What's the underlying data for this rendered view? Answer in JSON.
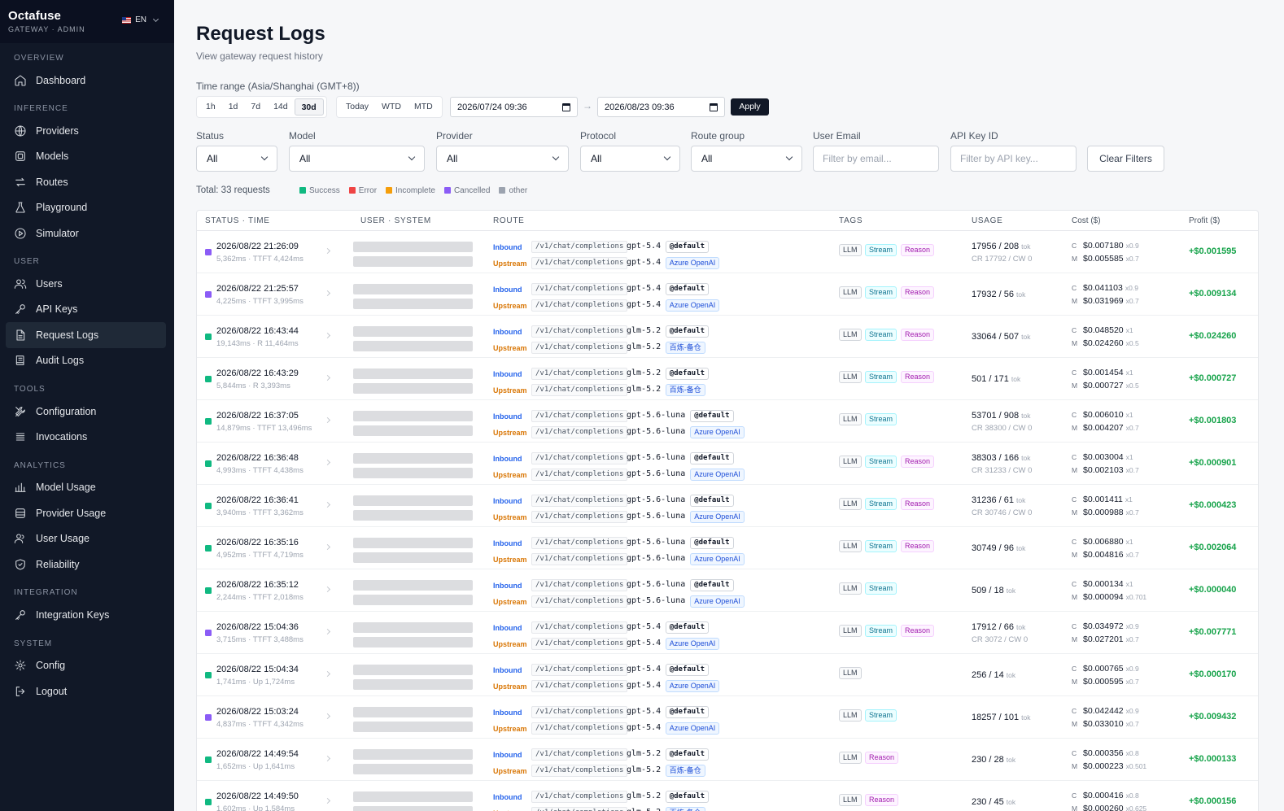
{
  "brand": {
    "name": "Octafuse",
    "sub": "GATEWAY · ADMIN",
    "lang": "EN"
  },
  "nav": [
    {
      "section": "OVERVIEW",
      "items": [
        {
          "label": "Dashboard",
          "icon": "home-icon"
        }
      ]
    },
    {
      "section": "INFERENCE",
      "items": [
        {
          "label": "Providers",
          "icon": "globe-icon"
        },
        {
          "label": "Models",
          "icon": "cube-icon"
        },
        {
          "label": "Routes",
          "icon": "arrows-icon"
        },
        {
          "label": "Playground",
          "icon": "flask-icon"
        },
        {
          "label": "Simulator",
          "icon": "play-circle-icon"
        }
      ]
    },
    {
      "section": "USER",
      "items": [
        {
          "label": "Users",
          "icon": "users-icon"
        },
        {
          "label": "API Keys",
          "icon": "key-icon"
        },
        {
          "label": "Request Logs",
          "icon": "file-icon",
          "active": true
        },
        {
          "label": "Audit Logs",
          "icon": "book-icon"
        }
      ]
    },
    {
      "section": "TOOLS",
      "items": [
        {
          "label": "Configuration",
          "icon": "tools-icon"
        },
        {
          "label": "Invocations",
          "icon": "list-icon"
        }
      ]
    },
    {
      "section": "ANALYTICS",
      "items": [
        {
          "label": "Model Usage",
          "icon": "bar-chart-icon"
        },
        {
          "label": "Provider Usage",
          "icon": "database-icon"
        },
        {
          "label": "User Usage",
          "icon": "user-group-icon"
        },
        {
          "label": "Reliability",
          "icon": "shield-icon"
        }
      ]
    },
    {
      "section": "INTEGRATION",
      "items": [
        {
          "label": "Integration Keys",
          "icon": "key-icon"
        }
      ]
    },
    {
      "section": "SYSTEM",
      "items": [
        {
          "label": "Config",
          "icon": "gear-icon"
        },
        {
          "label": "Logout",
          "icon": "logout-icon"
        }
      ]
    }
  ],
  "page": {
    "title": "Request Logs",
    "subtitle": "View gateway request history"
  },
  "time": {
    "label": "Time range (Asia/Shanghai (GMT+8))",
    "quick": [
      "1h",
      "1d",
      "7d",
      "14d",
      "30d"
    ],
    "quick_active": "30d",
    "periods": [
      "Today",
      "WTD",
      "MTD"
    ],
    "from": "2026/07/24 09:36",
    "to": "2026/08/23 09:36",
    "arrow": "→",
    "apply": "Apply"
  },
  "filters": {
    "status": {
      "label": "Status",
      "value": "All"
    },
    "model": {
      "label": "Model",
      "value": "All"
    },
    "provider": {
      "label": "Provider",
      "value": "All"
    },
    "protocol": {
      "label": "Protocol",
      "value": "All"
    },
    "route_group": {
      "label": "Route group",
      "value": "All"
    },
    "user_email": {
      "label": "User Email",
      "placeholder": "Filter by email..."
    },
    "api_key": {
      "label": "API Key ID",
      "placeholder": "Filter by API key..."
    },
    "clear": "Clear Filters"
  },
  "summary": {
    "total": "Total: 33 requests",
    "legend": [
      {
        "label": "Success",
        "color": "#10b981"
      },
      {
        "label": "Error",
        "color": "#ef4444"
      },
      {
        "label": "Incomplete",
        "color": "#f59e0b"
      },
      {
        "label": "Cancelled",
        "color": "#8b5cf6"
      },
      {
        "label": "other",
        "color": "#9ca3af"
      }
    ]
  },
  "columns": {
    "status_time": "STATUS · TIME",
    "user_system": "USER · SYSTEM",
    "route": "ROUTE",
    "tags": "TAGS",
    "usage": "USAGE",
    "cost": "Cost ($)",
    "profit": "Profit ($)"
  },
  "route_labels": {
    "inbound": "Inbound",
    "upstream": "Upstream",
    "default_badge": "@default",
    "tok": "tok",
    "c": "C",
    "m": "M"
  },
  "rows": [
    {
      "status": "cancelled",
      "time": "2026/08/22 21:26:09",
      "sub": "5,362ms · TTFT 4,424ms",
      "path": "/v1/chat/completions",
      "model": "gpt-5.4",
      "provider": "Azure OpenAI",
      "tags": [
        "LLM",
        "Stream",
        "Reason"
      ],
      "usage": "17956 / 208",
      "cache": "CR 17792 / CW 0",
      "cost_c": "$0.007180",
      "mult_c": "x0.9",
      "cost_m": "$0.005585",
      "mult_m": "x0.7",
      "profit": "+$0.001595"
    },
    {
      "status": "cancelled",
      "time": "2026/08/22 21:25:57",
      "sub": "4,225ms · TTFT 3,995ms",
      "path": "/v1/chat/completions",
      "model": "gpt-5.4",
      "provider": "Azure OpenAI",
      "tags": [
        "LLM",
        "Stream",
        "Reason"
      ],
      "usage": "17932 / 56",
      "cache": "",
      "cost_c": "$0.041103",
      "mult_c": "x0.9",
      "cost_m": "$0.031969",
      "mult_m": "x0.7",
      "profit": "+$0.009134"
    },
    {
      "status": "success",
      "time": "2026/08/22 16:43:44",
      "sub": "19,143ms · R 11,464ms",
      "path": "/v1/chat/completions",
      "model": "glm-5.2",
      "provider": "百炼-备仓",
      "tags": [
        "LLM",
        "Stream",
        "Reason"
      ],
      "usage": "33064 / 507",
      "cache": "",
      "cost_c": "$0.048520",
      "mult_c": "x1",
      "cost_m": "$0.024260",
      "mult_m": "x0.5",
      "profit": "+$0.024260"
    },
    {
      "status": "success",
      "time": "2026/08/22 16:43:29",
      "sub": "5,844ms · R 3,393ms",
      "path": "/v1/chat/completions",
      "model": "glm-5.2",
      "provider": "百炼-备仓",
      "tags": [
        "LLM",
        "Stream",
        "Reason"
      ],
      "usage": "501 / 171",
      "cache": "",
      "cost_c": "$0.001454",
      "mult_c": "x1",
      "cost_m": "$0.000727",
      "mult_m": "x0.5",
      "profit": "+$0.000727"
    },
    {
      "status": "success",
      "time": "2026/08/22 16:37:05",
      "sub": "14,879ms · TTFT 13,496ms",
      "path": "/v1/chat/completions",
      "model": "gpt-5.6-luna",
      "provider": "Azure OpenAI",
      "tags": [
        "LLM",
        "Stream"
      ],
      "usage": "53701 / 908",
      "cache": "CR 38300 / CW 0",
      "cost_c": "$0.006010",
      "mult_c": "x1",
      "cost_m": "$0.004207",
      "mult_m": "x0.7",
      "profit": "+$0.001803"
    },
    {
      "status": "success",
      "time": "2026/08/22 16:36:48",
      "sub": "4,993ms · TTFT 4,438ms",
      "path": "/v1/chat/completions",
      "model": "gpt-5.6-luna",
      "provider": "Azure OpenAI",
      "tags": [
        "LLM",
        "Stream",
        "Reason"
      ],
      "usage": "38303 / 166",
      "cache": "CR 31233 / CW 0",
      "cost_c": "$0.003004",
      "mult_c": "x1",
      "cost_m": "$0.002103",
      "mult_m": "x0.7",
      "profit": "+$0.000901"
    },
    {
      "status": "success",
      "time": "2026/08/22 16:36:41",
      "sub": "3,940ms · TTFT 3,362ms",
      "path": "/v1/chat/completions",
      "model": "gpt-5.6-luna",
      "provider": "Azure OpenAI",
      "tags": [
        "LLM",
        "Stream",
        "Reason"
      ],
      "usage": "31236 / 61",
      "cache": "CR 30746 / CW 0",
      "cost_c": "$0.001411",
      "mult_c": "x1",
      "cost_m": "$0.000988",
      "mult_m": "x0.7",
      "profit": "+$0.000423"
    },
    {
      "status": "success",
      "time": "2026/08/22 16:35:16",
      "sub": "4,952ms · TTFT 4,719ms",
      "path": "/v1/chat/completions",
      "model": "gpt-5.6-luna",
      "provider": "Azure OpenAI",
      "tags": [
        "LLM",
        "Stream",
        "Reason"
      ],
      "usage": "30749 / 96",
      "cache": "",
      "cost_c": "$0.006880",
      "mult_c": "x1",
      "cost_m": "$0.004816",
      "mult_m": "x0.7",
      "profit": "+$0.002064"
    },
    {
      "status": "success",
      "time": "2026/08/22 16:35:12",
      "sub": "2,244ms · TTFT 2,018ms",
      "path": "/v1/chat/completions",
      "model": "gpt-5.6-luna",
      "provider": "Azure OpenAI",
      "tags": [
        "LLM",
        "Stream"
      ],
      "usage": "509 / 18",
      "cache": "",
      "cost_c": "$0.000134",
      "mult_c": "x1",
      "cost_m": "$0.000094",
      "mult_m": "x0.701",
      "profit": "+$0.000040"
    },
    {
      "status": "cancelled",
      "time": "2026/08/22 15:04:36",
      "sub": "3,715ms · TTFT 3,488ms",
      "path": "/v1/chat/completions",
      "model": "gpt-5.4",
      "provider": "Azure OpenAI",
      "tags": [
        "LLM",
        "Stream",
        "Reason"
      ],
      "usage": "17912 / 66",
      "cache": "CR 3072 / CW 0",
      "cost_c": "$0.034972",
      "mult_c": "x0.9",
      "cost_m": "$0.027201",
      "mult_m": "x0.7",
      "profit": "+$0.007771"
    },
    {
      "status": "success",
      "time": "2026/08/22 15:04:34",
      "sub": "1,741ms · Up 1,724ms",
      "path": "/v1/chat/completions",
      "model": "gpt-5.4",
      "provider": "Azure OpenAI",
      "tags": [
        "LLM"
      ],
      "usage": "256 / 14",
      "cache": "",
      "cost_c": "$0.000765",
      "mult_c": "x0.9",
      "cost_m": "$0.000595",
      "mult_m": "x0.7",
      "profit": "+$0.000170"
    },
    {
      "status": "cancelled",
      "time": "2026/08/22 15:03:24",
      "sub": "4,837ms · TTFT 4,342ms",
      "path": "/v1/chat/completions",
      "model": "gpt-5.4",
      "provider": "Azure OpenAI",
      "tags": [
        "LLM",
        "Stream"
      ],
      "usage": "18257 / 101",
      "cache": "",
      "cost_c": "$0.042442",
      "mult_c": "x0.9",
      "cost_m": "$0.033010",
      "mult_m": "x0.7",
      "profit": "+$0.009432"
    },
    {
      "status": "success",
      "time": "2026/08/22 14:49:54",
      "sub": "1,652ms · Up 1,641ms",
      "path": "/v1/chat/completions",
      "model": "glm-5.2",
      "provider": "百炼-备仓",
      "tags": [
        "LLM",
        "Reason"
      ],
      "usage": "230 / 28",
      "cache": "",
      "cost_c": "$0.000356",
      "mult_c": "x0.8",
      "cost_m": "$0.000223",
      "mult_m": "x0.501",
      "profit": "+$0.000133"
    },
    {
      "status": "success",
      "time": "2026/08/22 14:49:50",
      "sub": "1,602ms · Up 1,584ms",
      "path": "/v1/chat/completions",
      "model": "glm-5.2",
      "provider": "百炼-备仓",
      "tags": [
        "LLM",
        "Reason"
      ],
      "usage": "230 / 45",
      "cache": "",
      "cost_c": "$0.000416",
      "mult_c": "x0.8",
      "cost_m": "$0.000260",
      "mult_m": "x0.625",
      "profit": "+$0.000156"
    }
  ]
}
